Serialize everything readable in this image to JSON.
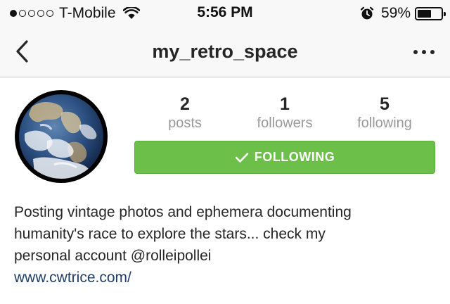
{
  "status_bar": {
    "signal_dots_filled": 1,
    "signal_dots_total": 5,
    "carrier": "T-Mobile",
    "time": "5:56 PM",
    "battery_percent": "59%",
    "battery_level": 0.59,
    "icons": [
      "wifi-icon",
      "alarm-icon",
      "battery-icon"
    ]
  },
  "navbar": {
    "title": "my_retro_space",
    "back_icon": "chevron-left-icon",
    "more_icon": "more-horizontal-icon"
  },
  "profile": {
    "avatar": "earth-photo",
    "stats": [
      {
        "value": "2",
        "label": "posts"
      },
      {
        "value": "1",
        "label": "followers"
      },
      {
        "value": "5",
        "label": "following"
      }
    ],
    "follow_button": {
      "label": "FOLLOWING",
      "icon": "checkmark-icon",
      "color": "#6cc04a"
    },
    "bio_lines": [
      "Posting vintage photos and ephemera documenting",
      "humanity's race to explore the stars... check my",
      "personal account @rolleipollei"
    ],
    "website": "www.cwtrice.com/"
  }
}
